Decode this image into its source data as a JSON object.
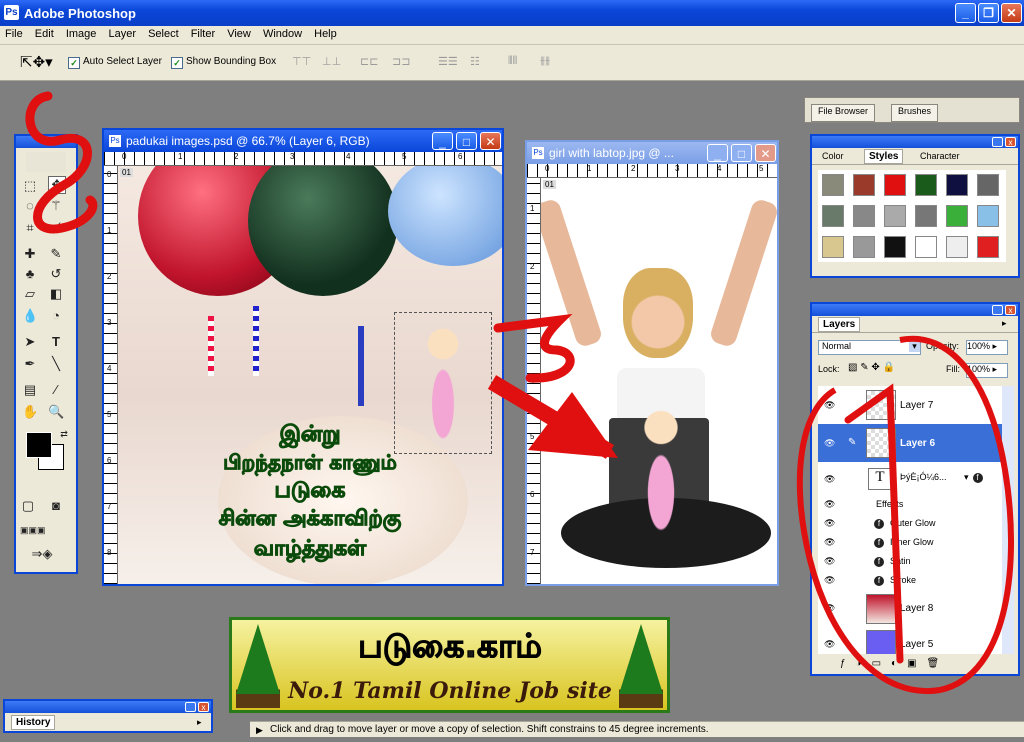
{
  "app": {
    "title": "Adobe Photoshop"
  },
  "menu": [
    "File",
    "Edit",
    "Image",
    "Layer",
    "Select",
    "Filter",
    "View",
    "Window",
    "Help"
  ],
  "options": {
    "auto_select": "Auto Select Layer",
    "show_bounding": "Show Bounding Box"
  },
  "well_tabs": [
    "File Browser",
    "Brushes"
  ],
  "doc1": {
    "title": "padukai images.psd @ 66.7% (Layer 6, RGB)",
    "ruler_h": [
      "0",
      "1",
      "2",
      "3",
      "4",
      "5",
      "6"
    ],
    "ruler_v": [
      "0",
      "1",
      "2",
      "3",
      "4",
      "5",
      "6",
      "7",
      "8"
    ],
    "tag": "01"
  },
  "tamil_lines": [
    "இன்று",
    "பிறந்தநாள் காணும்",
    "படுகை",
    "சின்ன அக்காவிற்கு",
    "வாழ்த்துகள்"
  ],
  "doc2": {
    "title": "girl with labtop.jpg @ ...",
    "ruler_h": [
      "0",
      "1",
      "2",
      "3",
      "4",
      "5"
    ],
    "ruler_v": [
      "1",
      "2",
      "3",
      "4",
      "5",
      "6",
      "7"
    ],
    "tag": "01"
  },
  "styles_panel": {
    "tabs": [
      "Color",
      "Styles",
      "Character"
    ]
  },
  "layers_panel": {
    "tab": "Layers",
    "blend_mode": "Normal",
    "opacity_label": "Opacity:",
    "opacity": "100%",
    "lock_label": "Lock:",
    "fill_label": "Fill:",
    "fill": "100%",
    "layers": [
      "Layer 7",
      "Layer 6",
      "Layer 8",
      "Layer 5"
    ],
    "text_layer": "ÞýÈ¡Ó¼6...",
    "effects_label": "Effects",
    "effects": [
      "Outer Glow",
      "Inner Glow",
      "Satin",
      "Stroke"
    ]
  },
  "banner": {
    "tamil": "படுகை.காம்",
    "english": "No.1 Tamil Online Job site"
  },
  "history": {
    "tab": "History"
  },
  "status": "Click and drag to move layer or move a copy of selection. Shift constrains to 45 degree increments.",
  "annotations": [
    "2",
    "3",
    "1"
  ],
  "colors": {
    "xp_blue": "#0a46d8",
    "panel_bg": "#ece9d8",
    "workspace": "#7f7f7f",
    "annotation_red": "#e01010",
    "selected_layer": "#3a6fd8"
  }
}
